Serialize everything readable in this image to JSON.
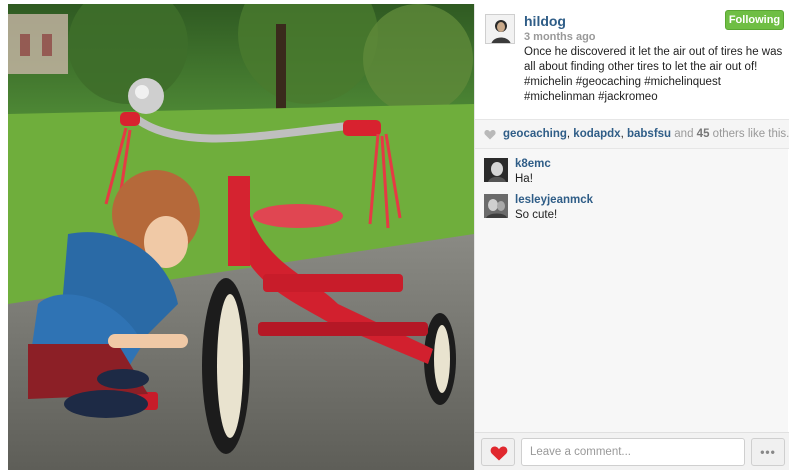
{
  "post": {
    "username": "hildog",
    "timestamp": "3 months ago",
    "follow_label": "Following",
    "caption": "Once he discovered it let the air out of tires he was all about finding other tires to let the air out of! #michelin #geocaching #michelinquest #michelinman #jackromeo",
    "photo_icon": "tricycle-photo"
  },
  "likes": {
    "icon": "heart-icon",
    "likers": [
      "geocaching",
      "kodapdx",
      "babsfsu"
    ],
    "and_text": "and",
    "count": "45",
    "suffix": "others like this."
  },
  "comments": [
    {
      "user": "k8emc",
      "text": "Ha!"
    },
    {
      "user": "lesleyjeanmck",
      "text": "So cute!"
    }
  ],
  "composer": {
    "placeholder": "Leave a comment...",
    "more_label": "•••"
  },
  "colors": {
    "link": "#2f5d87",
    "follow_green": "#6fbe44",
    "like_red": "#e0282e"
  }
}
